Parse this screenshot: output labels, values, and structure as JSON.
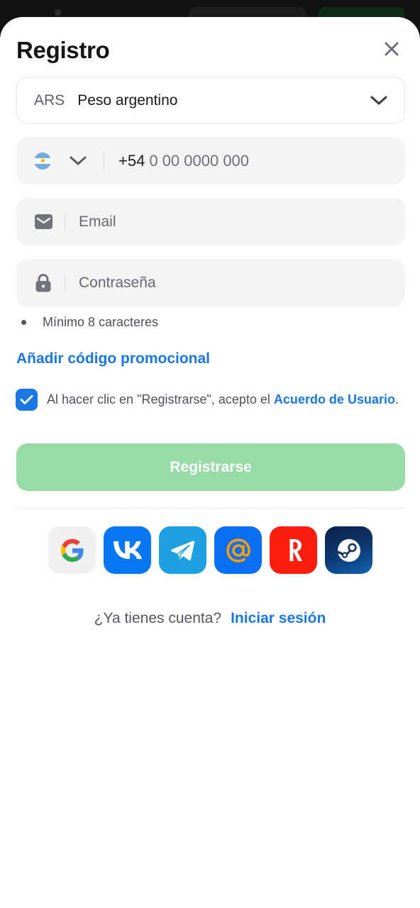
{
  "modal": {
    "title": "Registro"
  },
  "currency": {
    "code": "ARS",
    "name": "Peso argentino"
  },
  "phone": {
    "country_code": "+54",
    "placeholder": "0 00 0000 000",
    "flag_colors": [
      "#74acdf",
      "#ffffff",
      "#74acdf"
    ]
  },
  "email": {
    "placeholder": "Email"
  },
  "password": {
    "placeholder": "Contraseña",
    "hint": "Mínimo 8 caracteres"
  },
  "promo": {
    "label": "Añadir código promocional"
  },
  "agreement": {
    "checked": true,
    "text": "Al hacer clic en \"Registrarse\", acepto el ",
    "link": "Acuerdo de Usuario",
    "suffix": "."
  },
  "register_button": {
    "label": "Registrarse",
    "color": "#99dba7"
  },
  "socials": [
    {
      "name": "google",
      "icon": "google-icon"
    },
    {
      "name": "vk",
      "icon": "vk-icon"
    },
    {
      "name": "telegram",
      "icon": "telegram-icon"
    },
    {
      "name": "mail-ru",
      "icon": "at-icon"
    },
    {
      "name": "yandex",
      "icon": "yandex-icon"
    },
    {
      "name": "steam",
      "icon": "steam-icon"
    }
  ],
  "login": {
    "question": "¿Ya tienes cuenta?",
    "link": "Iniciar sesión"
  },
  "colors": {
    "accent": "#1a78e6",
    "field_bg": "#f4f4f5"
  }
}
